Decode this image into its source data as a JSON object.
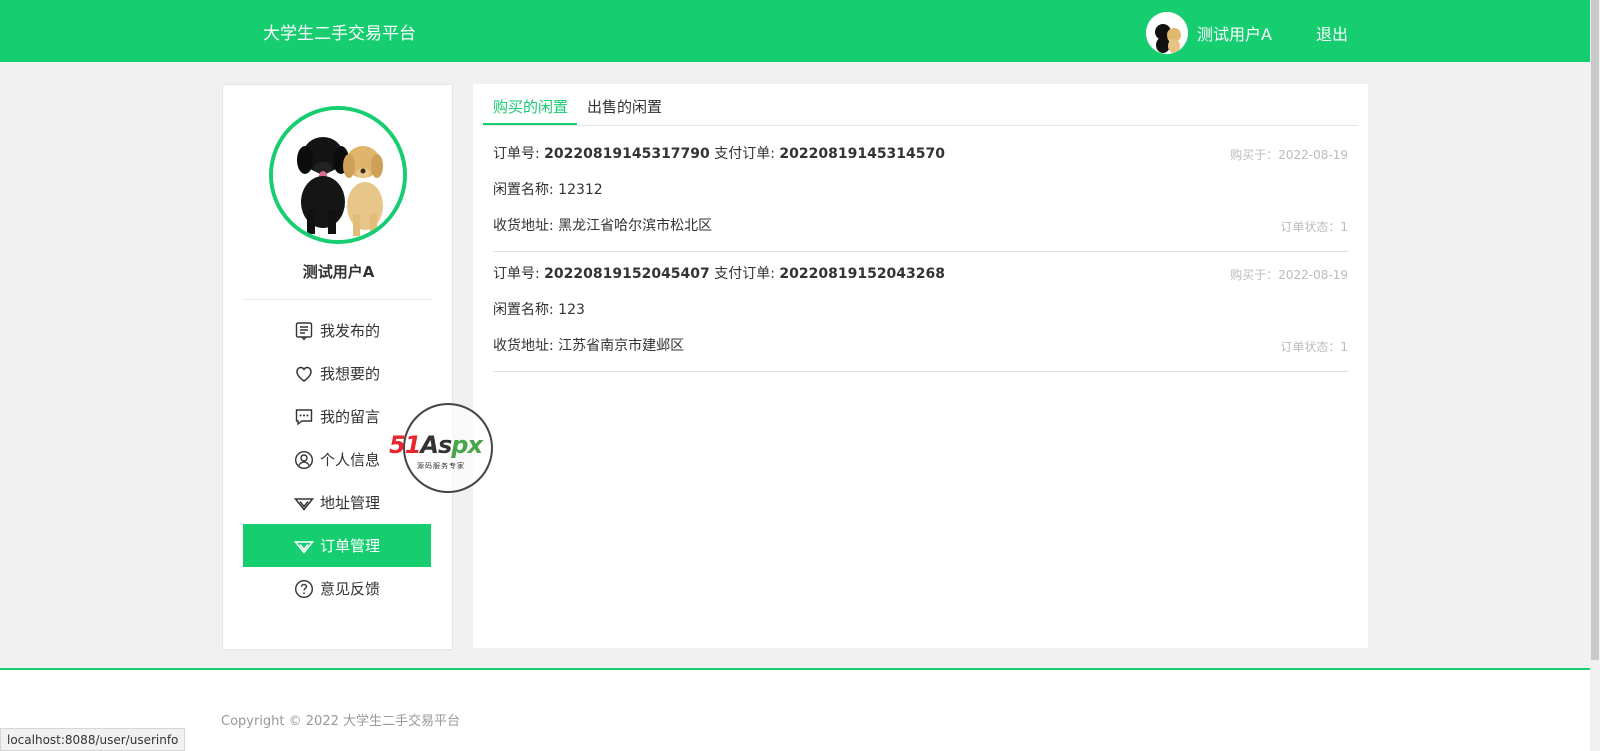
{
  "header": {
    "brand": "大学生二手交易平台",
    "username": "测试用户A",
    "logout_label": "退出"
  },
  "sidebar": {
    "username": "测试用户A",
    "items": [
      {
        "label": "我发布的",
        "icon": "list-icon"
      },
      {
        "label": "我想要的",
        "icon": "heart-icon"
      },
      {
        "label": "我的留言",
        "icon": "message-icon"
      },
      {
        "label": "个人信息",
        "icon": "user-icon"
      },
      {
        "label": "地址管理",
        "icon": "diamond-icon"
      },
      {
        "label": "订单管理",
        "icon": "diamond-icon",
        "active": true
      },
      {
        "label": "意见反馈",
        "icon": "help-icon"
      }
    ]
  },
  "tabs": [
    {
      "label": "购买的闲置",
      "active": true
    },
    {
      "label": "出售的闲置"
    }
  ],
  "orders": [
    {
      "order_label": "订单号:",
      "order_no": "20220819145317790",
      "pay_label": "支付订单:",
      "pay_no": "20220819145314570",
      "bought_at": "购买于：2022-08-19",
      "item_name_label": "闲置名称:",
      "item_name": "12312",
      "address_label": "收货地址:",
      "address": "黑龙江省哈尔滨市松北区",
      "status": "订单状态：1"
    },
    {
      "order_label": "订单号:",
      "order_no": "20220819152045407",
      "pay_label": "支付订单:",
      "pay_no": "20220819152043268",
      "bought_at": "购买于：2022-08-19",
      "item_name_label": "闲置名称:",
      "item_name": "123",
      "address_label": "收货地址:",
      "address": "江苏省南京市建邺区",
      "status": "订单状态：1"
    }
  ],
  "watermark": {
    "brand_red": "51",
    "brand_dark": "As",
    "brand_green": "px",
    "sub": "源码服务专家"
  },
  "footer": {
    "copyright": "Copyright © 2022 大学生二手交易平台"
  },
  "statusbar": {
    "url": "localhost:8088/user/userinfo"
  },
  "colors": {
    "accent": "#16cd70"
  }
}
